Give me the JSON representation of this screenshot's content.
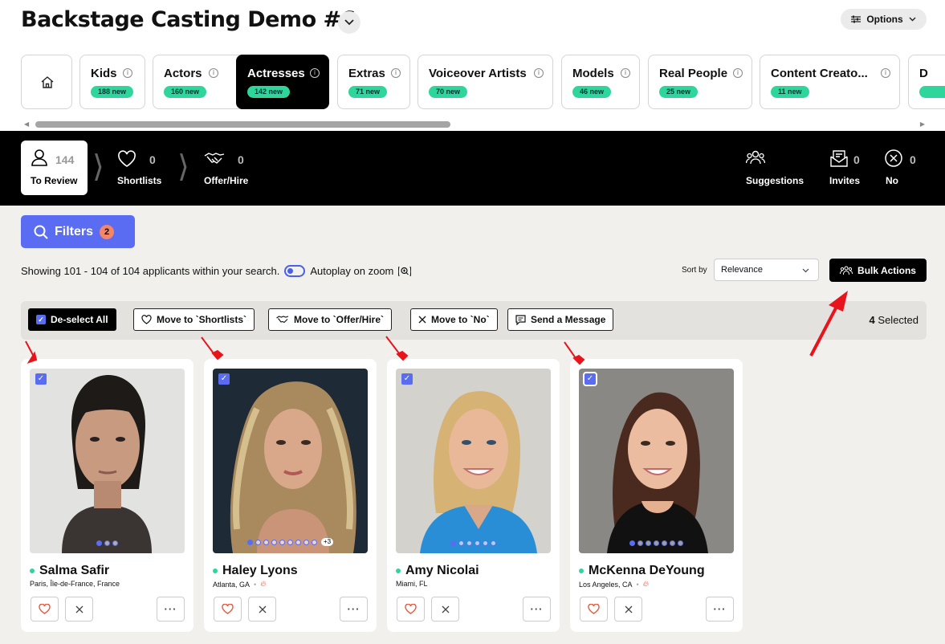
{
  "project": {
    "title": "Backstage Casting Demo #6",
    "options_label": "Options"
  },
  "categories": [
    {
      "label": "Kids",
      "badge": "188 new"
    },
    {
      "label": "Actors",
      "badge": "160 new"
    },
    {
      "label": "Actresses",
      "badge": "142 new",
      "active": true
    },
    {
      "label": "Extras",
      "badge": "71 new"
    },
    {
      "label": "Voiceover Artists",
      "badge": "70 new"
    },
    {
      "label": "Models",
      "badge": "46 new"
    },
    {
      "label": "Real People",
      "badge": "25 new"
    },
    {
      "label": "Content Creato...",
      "badge": "11 new"
    },
    {
      "label": "D",
      "badge": ""
    }
  ],
  "pipeline": {
    "to_review": {
      "count": "144",
      "label": "To Review"
    },
    "shortlists": {
      "count": "0",
      "label": "Shortlists"
    },
    "offer_hire": {
      "count": "0",
      "label": "Offer/Hire"
    },
    "suggestions": {
      "label": "Suggestions"
    },
    "invites": {
      "count": "0",
      "label": "Invites"
    },
    "no": {
      "count": "0",
      "label": "No"
    }
  },
  "filters": {
    "label": "Filters",
    "count": "2"
  },
  "results": {
    "showing": "Showing 101 - 104 of 104 applicants within your search.",
    "autoplay": "Autoplay on zoom"
  },
  "sort": {
    "label": "Sort by",
    "value": "Relevance"
  },
  "bulk_actions": "Bulk Actions",
  "actions": {
    "deselect": "De-select All",
    "shortlist": "Move to `Shortlists`",
    "offer": "Move to `Offer/Hire`",
    "no": "Move to `No`",
    "message": "Send a Message",
    "selected_count": "4",
    "selected_label": "Selected"
  },
  "applicants": [
    {
      "name": "Salma Safir",
      "location": "Paris, Île-de-France, France",
      "photos": 3,
      "extra": "",
      "fire": false
    },
    {
      "name": "Haley Lyons",
      "location": "Atlanta, GA",
      "photos": 9,
      "extra": "+3",
      "fire": true
    },
    {
      "name": "Amy Nicolai",
      "location": "Miami, FL",
      "photos": 6,
      "extra": "",
      "fire": false
    },
    {
      "name": "McKenna DeYoung",
      "location": "Los Angeles, CA",
      "photos": 7,
      "extra": "",
      "fire": true
    }
  ],
  "colors": {
    "accent": "#5a6cf1",
    "badge": "#2fd69b",
    "annotation": "#e8141b"
  }
}
